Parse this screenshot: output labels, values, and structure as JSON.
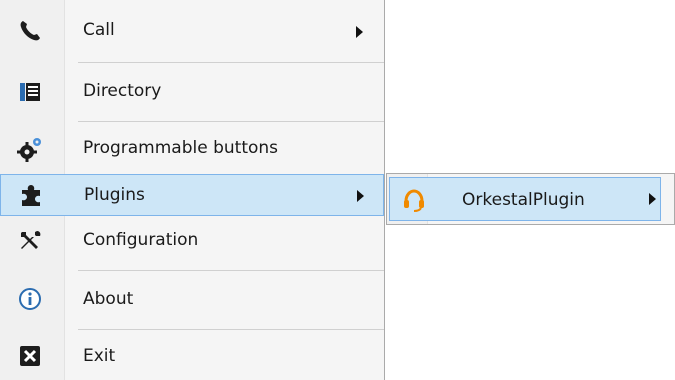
{
  "menu": {
    "items": [
      {
        "label": "Call",
        "icon": "phone-icon",
        "has_submenu": true
      },
      {
        "label": "Directory",
        "icon": "directory-icon",
        "has_submenu": false
      },
      {
        "label": "Programmable buttons",
        "icon": "gears-icon",
        "has_submenu": false
      },
      {
        "label": "Plugins",
        "icon": "puzzle-icon",
        "has_submenu": true,
        "selected": true
      },
      {
        "label": "Configuration",
        "icon": "tools-icon",
        "has_submenu": false
      },
      {
        "label": "About",
        "icon": "info-icon",
        "has_submenu": false
      },
      {
        "label": "Exit",
        "icon": "exit-icon",
        "has_submenu": false
      }
    ]
  },
  "submenu": {
    "items": [
      {
        "label": "OrkestalPlugin",
        "icon": "headset-icon",
        "has_submenu": true,
        "selected": true
      }
    ]
  },
  "colors": {
    "highlight_bg": "#cde6f7",
    "highlight_border": "#7eb4ea",
    "headset_orange": "#f08a00"
  }
}
